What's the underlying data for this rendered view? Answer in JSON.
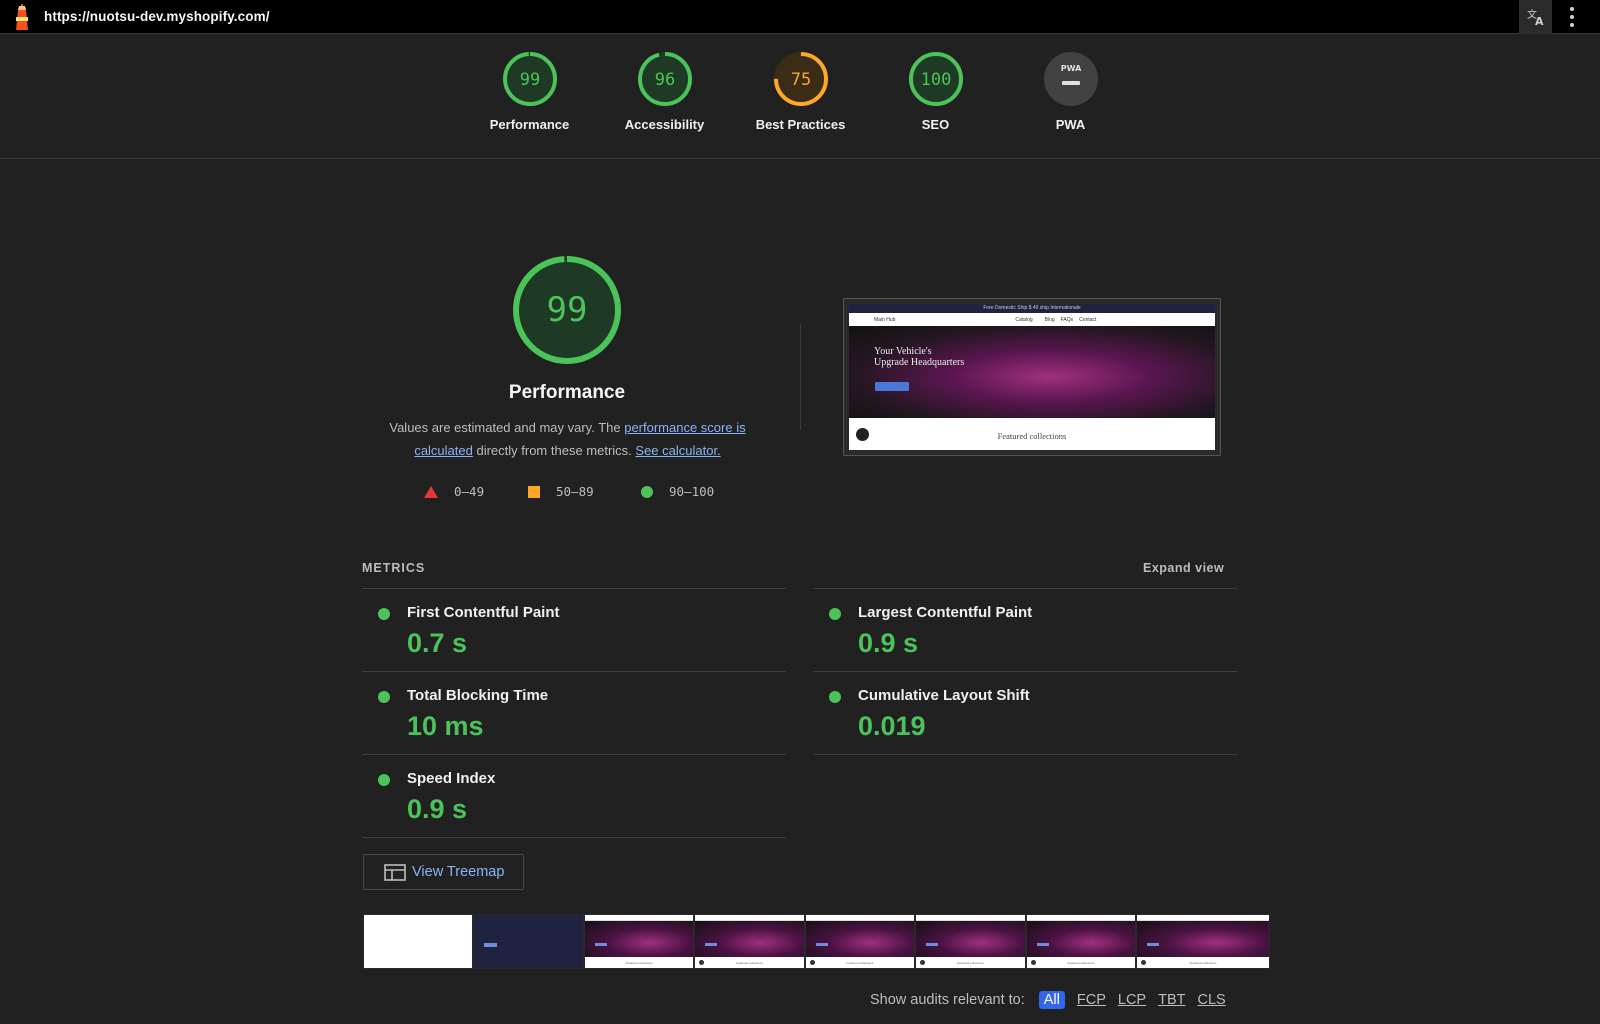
{
  "browser": {
    "url": "https://nuotsu-dev.myshopify.com/"
  },
  "gauges": [
    {
      "score": "99",
      "label": "Performance",
      "fraction": 0.99,
      "color": "#4cc35a"
    },
    {
      "score": "96",
      "label": "Accessibility",
      "fraction": 0.96,
      "color": "#4cc35a"
    },
    {
      "score": "75",
      "label": "Best Practices",
      "fraction": 0.75,
      "color": "#ffa726"
    },
    {
      "score": "100",
      "label": "SEO",
      "fraction": 1.0,
      "color": "#4cc35a"
    },
    {
      "score": "PWA",
      "label": "PWA",
      "fraction": 0,
      "color": "#9e9e9e"
    }
  ],
  "performance": {
    "score": "99",
    "fraction": 0.99,
    "title": "Performance",
    "desc_1": "Values are estimated and may vary. The ",
    "link_1": "performance score is calculated",
    "desc_2": " directly from these metrics. ",
    "link_2": "See calculator.",
    "legend": [
      {
        "range": "0–49",
        "color": "#e53935"
      },
      {
        "range": "50–89",
        "color": "#ffa726"
      },
      {
        "range": "90–100",
        "color": "#4cc35a"
      }
    ]
  },
  "thumbnail": {
    "banner": "Free Domestic Ship $ 49 ship Internationale",
    "nav_brand": "Main Hub",
    "nav_links": [
      "Catalog",
      "Blog",
      "FAQs",
      "Contact"
    ],
    "hero_line1": "Your Vehicle's",
    "hero_line2": "Upgrade Headquarters",
    "featured": "Featured collections"
  },
  "metrics": {
    "header": "METRICS",
    "expand": "Expand view",
    "items": [
      {
        "label": "First Contentful Paint",
        "value": "0.7 s"
      },
      {
        "label": "Largest Contentful Paint",
        "value": "0.9 s"
      },
      {
        "label": "Total Blocking Time",
        "value": "10 ms"
      },
      {
        "label": "Cumulative Layout Shift",
        "value": "0.019"
      },
      {
        "label": "Speed Index",
        "value": "0.9 s"
      }
    ],
    "status_color": "#4cc35a"
  },
  "treemap": {
    "label": "View Treemap"
  },
  "audits": {
    "label": "Show audits relevant to:",
    "chips": [
      "All",
      "FCP",
      "LCP",
      "TBT",
      "CLS"
    ],
    "active": "All"
  }
}
